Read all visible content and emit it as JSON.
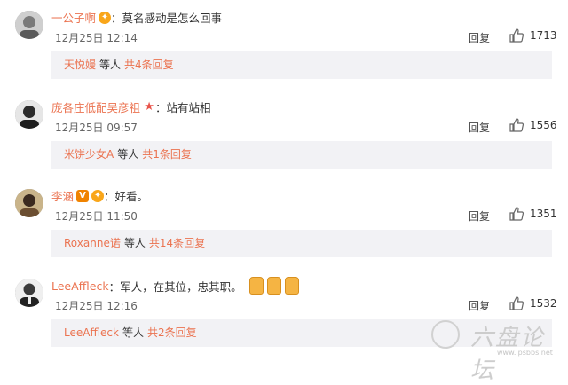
{
  "comments": [
    {
      "username": "一公子啊",
      "sep": "：",
      "text": "莫名感动是怎么回事",
      "time": "12月25日 12:14",
      "reply": "回复",
      "likes": "1713",
      "sub": {
        "names": "天悦嫚",
        "mid": "等人",
        "total": "共4条回复"
      }
    },
    {
      "username": "庞各庄低配吴彦祖",
      "sep": "：",
      "text": "站有站相",
      "time": "12月25日 09:57",
      "reply": "回复",
      "likes": "1556",
      "sub": {
        "names": "米饼少女A",
        "mid": "等人",
        "total": "共1条回复"
      }
    },
    {
      "username": "李涵",
      "sep": "：",
      "text": "好看。",
      "time": "12月25日 11:50",
      "reply": "回复",
      "likes": "1351",
      "sub": {
        "names": "Roxanne诺",
        "mid": "等人",
        "total": "共14条回复"
      }
    },
    {
      "username": "LeeAffleck",
      "sep": "：",
      "text": "军人，在其位，忠其职。",
      "time": "12月25日 12:16",
      "reply": "回复",
      "likes": "1532",
      "sub": {
        "names": "LeeAffleck",
        "mid": "等人",
        "total": "共2条回复"
      }
    }
  ],
  "badges": {
    "v": "V"
  },
  "watermark": {
    "text": "六盘论坛",
    "url": "www.lpsbbs.net"
  },
  "colors": {
    "username": "#eb7350",
    "subbar_bg": "#f2f2f5"
  }
}
